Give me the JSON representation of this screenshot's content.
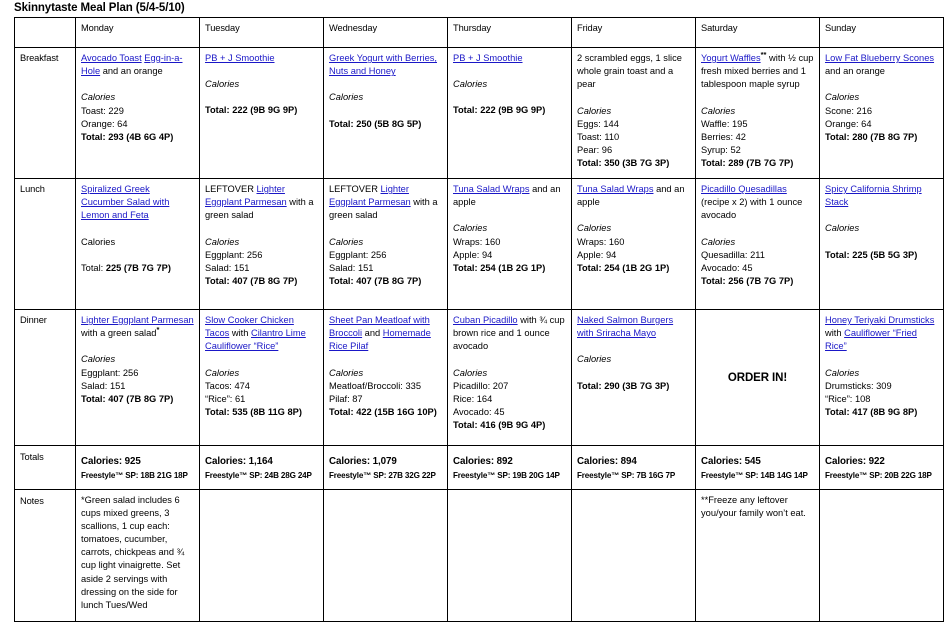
{
  "title": "Skinnytaste Meal Plan (5/4-5/10)",
  "link_color": "#1A17C7",
  "table": {
    "corner_label": "",
    "day_headers": [
      "Monday",
      "Tuesday",
      "Wednesday",
      "Thursday",
      "Friday",
      "Saturday",
      "Sunday"
    ],
    "row_labels": {
      "breakfast": "Breakfast",
      "lunch": "Lunch",
      "dinner": "Dinner",
      "totals": "Totals",
      "notes": "Notes"
    }
  },
  "breakfast": {
    "monday": {
      "link1": "Avocado Toast",
      "link2": "Egg-in-a-Hole",
      "rest": " and an orange",
      "cal_header": "Calories",
      "items": [
        "Toast: 229",
        "Orange: 64"
      ],
      "total": "Total: 293 (4B 6G 4P)"
    },
    "tuesday": {
      "link1": "PB + J Smoothie",
      "cal_header": "Calories",
      "items": [],
      "total": "Total: 222 (9B 9G 9P)"
    },
    "wednesday": {
      "link1": "Greek Yogurt with Berries, Nuts and Honey",
      "cal_header": "Calories",
      "items": [],
      "total": "Total: 250 (5B 8G 5P)"
    },
    "thursday": {
      "link1": "PB + J Smoothie",
      "cal_header": "Calories",
      "items": [],
      "total": "Total: 222 (9B 9G 9P)"
    },
    "friday": {
      "plain": "2 scrambled eggs, 1 slice whole grain toast and a pear",
      "cal_header": "Calories",
      "items": [
        "Eggs: 144",
        "Toast: 110",
        "Pear: 96"
      ],
      "total": "Total: 350 (3B 7G 3P)"
    },
    "saturday": {
      "link1": "Yogurt Waffles",
      "marker": "**",
      "rest": " with ½ cup fresh mixed berries and 1 tablespoon maple syrup",
      "cal_header": "Calories",
      "items": [
        "Waffle: 195",
        "Berries: 42",
        "Syrup: 52"
      ],
      "total": "Total: 289 (7B 7G 7P)"
    },
    "sunday": {
      "link1": "Low Fat Blueberry Scones",
      "rest": " and an orange",
      "cal_header": "Calories",
      "items": [
        "Scone: 216",
        "Orange: 64"
      ],
      "total": "Total: 280 (7B 8G 7P)"
    }
  },
  "lunch": {
    "monday": {
      "link1": "Spiralized Greek Cucumber Salad with Lemon and Feta",
      "cal_header": "Calories",
      "items": [],
      "total_label": "Total: ",
      "total_value": "225 (7B 7G 7P)"
    },
    "tuesday": {
      "prefix": "LEFTOVER ",
      "link1": "Lighter Eggplant Parmesan",
      "rest": " with a green salad",
      "cal_header": "Calories",
      "items": [
        "Eggplant: 256",
        "Salad: 151"
      ],
      "total": "Total: 407 (7B 8G 7P)"
    },
    "wednesday": {
      "prefix": "LEFTOVER ",
      "link1": "Lighter Eggplant Parmesan",
      "rest": " with a green salad",
      "cal_header": "Calories",
      "items": [
        "Eggplant: 256",
        "Salad: 151"
      ],
      "total": "Total: 407 (7B 8G 7P)"
    },
    "thursday": {
      "link1": "Tuna Salad Wraps",
      "rest": " and an apple",
      "cal_header": "Calories",
      "items": [
        "Wraps: 160",
        "Apple: 94"
      ],
      "total": "Total: 254 (1B 2G 1P)"
    },
    "friday": {
      "link1": "Tuna Salad Wraps",
      "rest": " and an apple",
      "cal_header": "Calories",
      "items": [
        "Wraps: 160",
        "Apple: 94"
      ],
      "total": "Total: 254 (1B 2G 1P)"
    },
    "saturday": {
      "link1": "Picadillo Quesadillas",
      "rest": " (recipe x 2) with 1 ounce avocado",
      "cal_header": "Calories",
      "items": [
        "Quesadilla: 211",
        "Avocado: 45"
      ],
      "total": "Total: 256 (7B 7G 7P)"
    },
    "sunday": {
      "link1": "Spicy California Shrimp Stack",
      "cal_header": "Calories",
      "items": [],
      "total": "Total: 225 (5B 5G 3P)"
    }
  },
  "dinner": {
    "monday": {
      "link1": "Lighter Eggplant Parmesan",
      "rest": " with a green salad",
      "marker": "*",
      "cal_header": "Calories",
      "items": [
        "Eggplant: 256",
        "Salad: 151"
      ],
      "total": "Total: 407 (7B 8G 7P)"
    },
    "tuesday": {
      "link1": "Slow Cooker Chicken Tacos",
      "mid": " with ",
      "link2": "Cilantro Lime Cauliflower “Rice”",
      "cal_header": "Calories",
      "items": [
        "Tacos: 474",
        "“Rice”: 61"
      ],
      "total": "Total: 535 (8B 11G 8P)"
    },
    "wednesday": {
      "link1": "Sheet Pan Meatloaf with Broccoli",
      "mid": " and ",
      "link2": "Homemade Rice Pilaf",
      "cal_header": "Calories",
      "items": [
        "Meatloaf/Broccoli: 335",
        "Pilaf: 87"
      ],
      "total": "Total: 422 (15B 16G 10P)"
    },
    "thursday": {
      "link1": "Cuban Picadillo",
      "rest": " with ¾ cup brown rice and 1 ounce avocado",
      "cal_header": "Calories",
      "items": [
        "Picadillo: 207",
        "Rice: 164",
        "Avocado: 45"
      ],
      "total": "Total: 416 (9B 9G 4P)"
    },
    "friday": {
      "link1": "Naked Salmon Burgers with Sriracha Mayo",
      "cal_header": "Calories",
      "items": [],
      "total": "Total: 290 (3B 7G 3P)"
    },
    "saturday": {
      "order_in": "ORDER IN!"
    },
    "sunday": {
      "link1": "Honey Teriyaki Drumsticks",
      "mid": " with ",
      "link2": "Cauliflower “Fried Rice”",
      "cal_header": "Calories",
      "items": [
        "Drumsticks: 309",
        "“Rice”: 108"
      ],
      "total": "Total: 417 (8B 9G 8P)"
    }
  },
  "totals": {
    "monday": {
      "calories": "Calories: 925",
      "sp": "Freestyle™ SP: 18B 21G 18P"
    },
    "tuesday": {
      "calories": "Calories: 1,164",
      "sp": "Freestyle™ SP: 24B 28G 24P"
    },
    "wednesday": {
      "calories": "Calories: 1,079",
      "sp": "Freestyle™ SP: 27B 32G 22P"
    },
    "thursday": {
      "calories": "Calories: 892",
      "sp": "Freestyle™ SP: 19B 20G 14P"
    },
    "friday": {
      "calories": "Calories: 894",
      "sp": "Freestyle™ SP: 7B 16G 7P"
    },
    "saturday": {
      "calories": "Calories: 545",
      "sp": "Freestyle™ SP: 14B 14G 14P"
    },
    "sunday": {
      "calories": "Calories: 922",
      "sp": "Freestyle™ SP: 20B 22G 18P"
    }
  },
  "notes": {
    "monday": "*Green salad includes 6 cups mixed greens, 3 scallions, 1 cup each: tomatoes, cucumber, carrots, chickpeas and ¾ cup light vinaigrette.  Set aside 2 servings with dressing on the side for lunch Tues/Wed",
    "tuesday": "",
    "wednesday": "",
    "thursday": "",
    "friday": "",
    "saturday": "**Freeze any leftover you/your family won’t eat.",
    "sunday": ""
  }
}
